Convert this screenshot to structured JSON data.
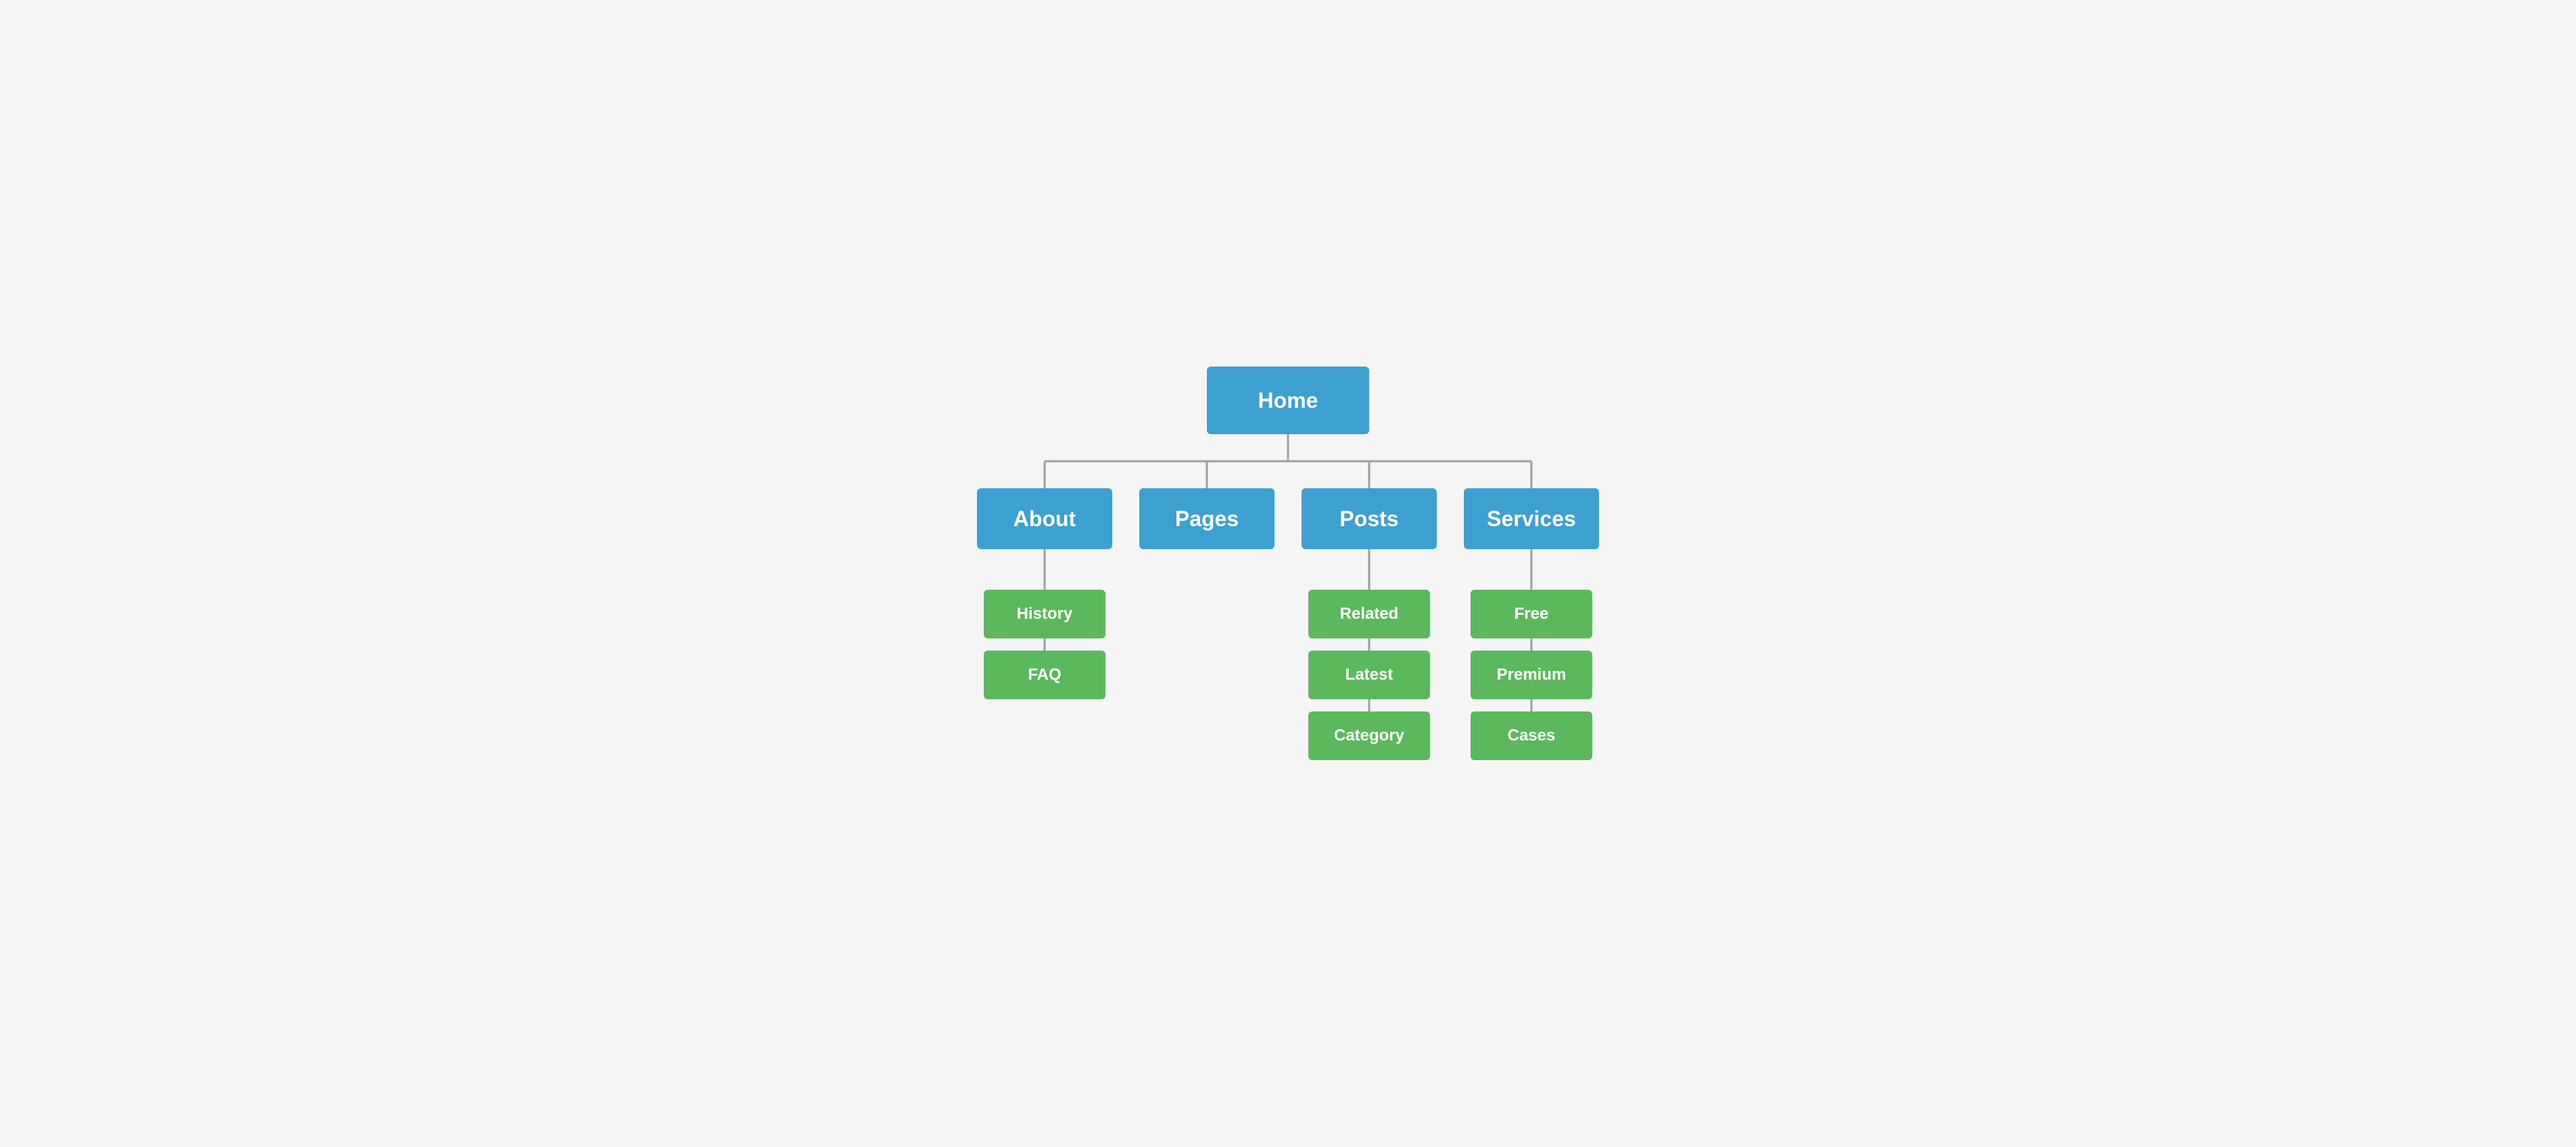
{
  "tree": {
    "root": {
      "label": "Home",
      "color": "blue"
    },
    "level1": [
      {
        "label": "About",
        "color": "blue",
        "children": [
          {
            "label": "History",
            "color": "green"
          },
          {
            "label": "FAQ",
            "color": "green"
          }
        ]
      },
      {
        "label": "Pages",
        "color": "blue",
        "children": []
      },
      {
        "label": "Posts",
        "color": "blue",
        "children": [
          {
            "label": "Related",
            "color": "green"
          },
          {
            "label": "Latest",
            "color": "green"
          },
          {
            "label": "Category",
            "color": "green"
          }
        ]
      },
      {
        "label": "Services",
        "color": "blue",
        "children": [
          {
            "label": "Free",
            "color": "green"
          },
          {
            "label": "Premium",
            "color": "green"
          },
          {
            "label": "Cases",
            "color": "green"
          }
        ]
      }
    ]
  },
  "colors": {
    "blue": "#3ca0d0",
    "green": "#5cb85c",
    "line": "#9e9e9e"
  }
}
